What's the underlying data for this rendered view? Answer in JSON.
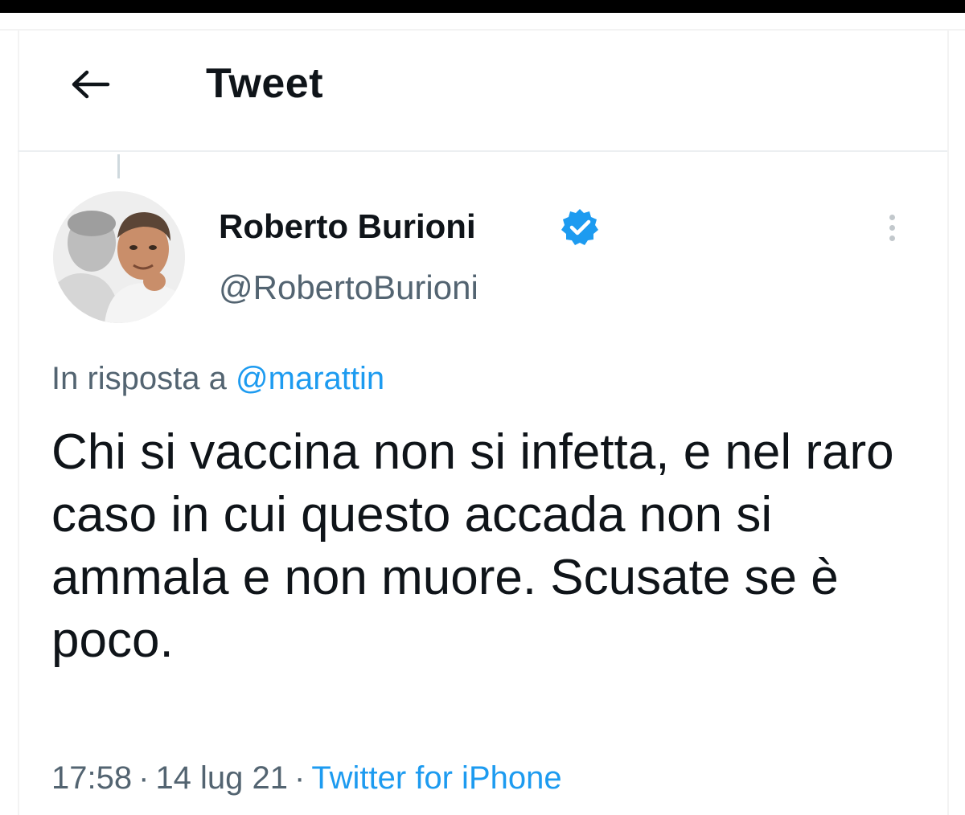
{
  "header": {
    "title": "Tweet",
    "back_icon": "arrow-left-icon"
  },
  "tweet": {
    "author": {
      "display_name": "Roberto Burioni",
      "handle": "@RobertoBurioni",
      "verified": true,
      "verified_color": "#1d9bf0"
    },
    "reply_context": {
      "prefix": "In risposta a",
      "mention": "@marattin"
    },
    "text": "Chi si vaccina non si infetta, e nel raro caso in cui questo accada non si ammala e non muore. Scusate se è poco.",
    "time": "17:58",
    "date": "14 lug 21",
    "separator": "·",
    "source": "Twitter for iPhone"
  },
  "colors": {
    "text_primary": "#0f1419",
    "text_secondary": "#536471",
    "link": "#1d9bf0"
  }
}
